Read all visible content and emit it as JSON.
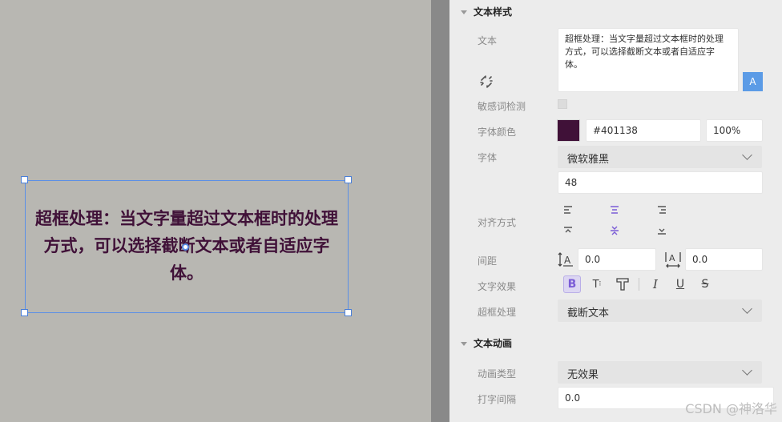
{
  "canvas": {
    "text_content": "超框处理：当文字量超过文本框时的处理方式，可以选择截断文本或者自适应字体。"
  },
  "panel": {
    "text_style": {
      "title": "文本样式",
      "text_label": "文本",
      "text_value": "超框处理：当文字量超过文本框时的处理方式，可以选择截断文本或者自适应字体。",
      "ai_button": "A",
      "sensitive_label": "敏感词检测",
      "color_label": "字体颜色",
      "color_hex": "#401138",
      "opacity": "100%",
      "font_label": "字体",
      "font_family": "微软雅黑",
      "font_size": "48",
      "align_label": "对齐方式",
      "spacing_label": "间距",
      "line_spacing": "0.0",
      "letter_spacing": "0.0",
      "effects_label": "文字效果",
      "overflow_label": "超框处理",
      "overflow_value": "截断文本"
    },
    "text_animation": {
      "title": "文本动画",
      "anim_type_label": "动画类型",
      "anim_type_value": "无效果",
      "typing_label": "打字间隔",
      "typing_value": "0.0"
    }
  },
  "watermark": "CSDN @神洛华",
  "colors": {
    "text": "#401138",
    "accent": "#5b8fe6",
    "active": "#7b5cd6"
  }
}
